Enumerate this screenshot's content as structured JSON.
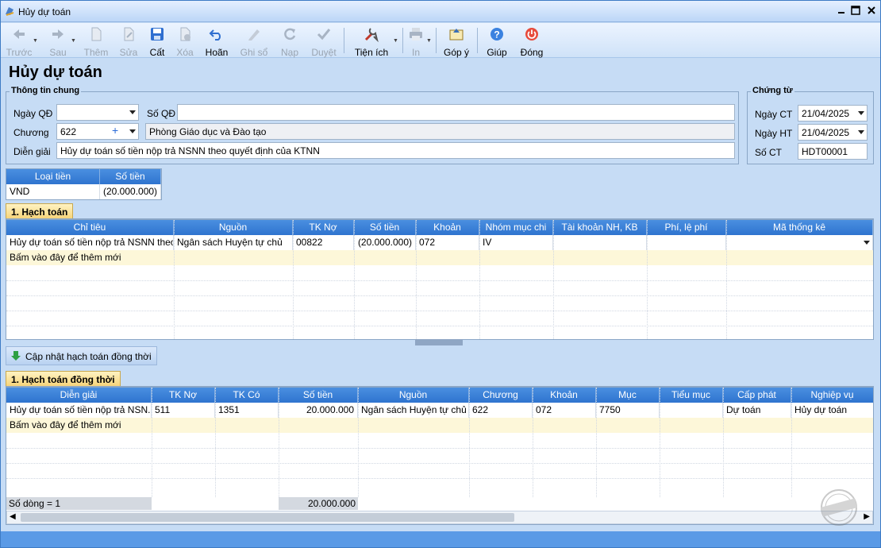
{
  "window": {
    "title": "Hủy dự toán"
  },
  "toolbar": {
    "prev": "Trước",
    "next": "Sau",
    "add": "Thêm",
    "edit": "Sửa",
    "save": "Cất",
    "delete": "Xóa",
    "undo": "Hoãn",
    "post": "Ghi sổ",
    "reload": "Nạp",
    "approve": "Duyệt",
    "utilities": "Tiện ích",
    "print": "In",
    "feedback": "Góp ý",
    "help": "Giúp",
    "close": "Đóng"
  },
  "page": {
    "title": "Hủy dự toán"
  },
  "general": {
    "legend": "Thông tin chung",
    "ngay_qd_label": "Ngày QĐ",
    "ngay_qd_value": "",
    "so_qd_label": "Số QĐ",
    "so_qd_value": "",
    "chuong_label": "Chương",
    "chuong_value": "622",
    "chuong_name": "Phòng Giáo dục và Đào tạo",
    "dien_giai_label": "Diễn giải",
    "dien_giai_value": "Hủy dự toán số tiền nộp trả NSNN theo quyết định của KTNN"
  },
  "voucher": {
    "legend": "Chứng từ",
    "ngay_ct_label": "Ngày CT",
    "ngay_ct_value": "21/04/2025",
    "ngay_ht_label": "Ngày HT",
    "ngay_ht_value": "21/04/2025",
    "so_ct_label": "Số CT",
    "so_ct_value": "HDT00001"
  },
  "currency": {
    "headers": [
      "Loại tiền",
      "Số tiền"
    ],
    "rows": [
      [
        "VND",
        "(20.000.000)"
      ]
    ]
  },
  "hach_toan": {
    "tab": "1. Hạch toán",
    "headers": [
      "Chỉ tiêu",
      "Nguồn",
      "TK Nợ",
      "Số tiền",
      "Khoản",
      "Nhóm mục chi",
      "Tài khoản NH, KB",
      "Phí, lệ phí",
      "Mã thống kê"
    ],
    "rows": [
      [
        "Hủy dự toán số tiền nộp trả NSNN theo...",
        "Ngân sách Huyện tự chủ",
        "00822",
        "(20.000.000)",
        "072",
        "IV",
        "",
        "",
        ""
      ]
    ],
    "new_row": "Bấm vào đây để thêm mới"
  },
  "update_button": "Cập nhật hạch toán đồng thời",
  "dong_thoi": {
    "tab": "1. Hạch toán đồng thời",
    "headers": [
      "Diễn giải",
      "TK Nợ",
      "TK Có",
      "Số tiền",
      "Nguồn",
      "Chương",
      "Khoản",
      "Mục",
      "Tiểu mục",
      "Cấp phát",
      "Nghiệp vụ"
    ],
    "rows": [
      [
        "Hủy dự toán số tiền nộp trả NSN...",
        "511",
        "1351",
        "20.000.000",
        "Ngân sách Huyện tự chủ",
        "622",
        "072",
        "7750",
        "",
        "Dự toán",
        "Hủy dự toán"
      ]
    ],
    "new_row": "Bấm vào đây để thêm mới",
    "row_count": "Số dòng = 1",
    "total": "20.000.000"
  },
  "colors": {
    "accent": "#2f74cf",
    "background": "#c6dcf5",
    "new_row": "#fdf7d9",
    "status": "#5a9ae6"
  }
}
